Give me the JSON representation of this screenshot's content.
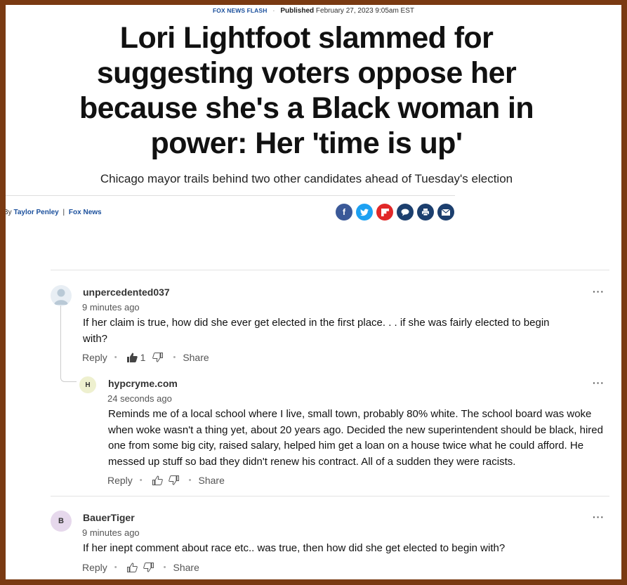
{
  "article": {
    "kicker": "FOX NEWS FLASH",
    "published_label": "Published",
    "published_date": "February 27, 2023 9:05am EST",
    "headline": "Lori Lightfoot slammed for suggesting voters oppose her because she's a Black woman in power: Her 'time is up'",
    "subhead": "Chicago mayor trails behind two other candidates ahead of Tuesday's election",
    "byline_prefix": "By",
    "author": "Taylor Penley",
    "outlet": "Fox News",
    "share_icons": [
      "facebook-icon",
      "twitter-icon",
      "flipboard-icon",
      "comments-icon",
      "print-icon",
      "email-icon"
    ]
  },
  "comments": [
    {
      "username": "unpercedented037",
      "time": "9 minutes ago",
      "text": "If her claim is true, how did she ever get elected in the first place. . . if she was fairly elected to begin with?",
      "reply_label": "Reply",
      "likes": "1",
      "share_label": "Share",
      "more": "···"
    },
    {
      "avatar_letter": "H",
      "username": "hypcryme.com",
      "time": "24 seconds ago",
      "text": "Reminds me of a local school where I live, small town, probably 80% white.  The school board was woke when woke wasn't a thing yet, about 20 years ago.  Decided the new superintendent should be black, hired one from some big city, raised salary, helped him get a loan on a house twice what he could afford.  He messed up stuff so bad they didn't renew his contract.  All of a sudden they were racists.",
      "reply_label": "Reply",
      "share_label": "Share",
      "more": "···"
    },
    {
      "avatar_letter": "B",
      "username": "BauerTiger",
      "time": "9 minutes ago",
      "text": "If her inept comment about race etc.. was true, then how did she get elected to begin with?",
      "reply_label": "Reply",
      "share_label": "Share",
      "more": "···"
    }
  ]
}
